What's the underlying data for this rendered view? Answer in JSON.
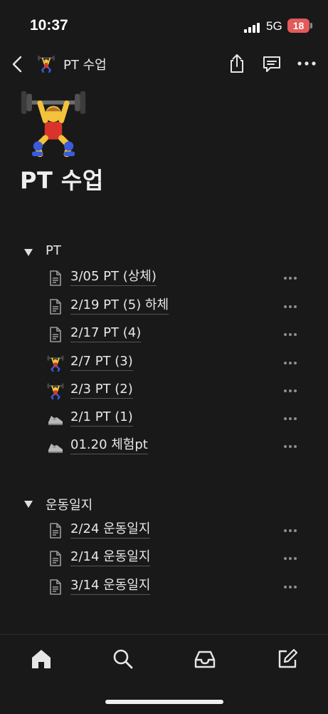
{
  "status": {
    "time": "10:37",
    "network": "5G",
    "battery": "18"
  },
  "nav": {
    "title": "PT 수업",
    "icons": [
      "back-chevron-icon",
      "weightlifter-emoji",
      "share-icon",
      "comment-icon",
      "more-icon"
    ]
  },
  "page": {
    "title": "PT 수업",
    "icon": "weightlifter-emoji"
  },
  "sections": [
    {
      "title": "PT",
      "items": [
        {
          "label": "3/05 PT (상체)",
          "icon": "page-icon"
        },
        {
          "label": "2/19 PT (5) 하체",
          "icon": "page-icon"
        },
        {
          "label": "2/17 PT (4)",
          "icon": "page-icon"
        },
        {
          "label": "2/7 PT (3)",
          "icon": "weightlifter-emoji"
        },
        {
          "label": "2/3 PT (2)",
          "icon": "weightlifter-emoji"
        },
        {
          "label": "2/1 PT (1)",
          "icon": "sneaker-emoji"
        },
        {
          "label": "01.20 체험pt",
          "icon": "sneaker-emoji"
        }
      ]
    },
    {
      "title": "운동일지",
      "items": [
        {
          "label": "2/24 운동일지",
          "icon": "page-icon"
        },
        {
          "label": "2/14 운동일지",
          "icon": "page-icon"
        },
        {
          "label": "3/14 운동일지",
          "icon": "page-icon"
        }
      ]
    }
  ],
  "tabbar": {
    "items": [
      "home-icon",
      "search-icon",
      "inbox-icon",
      "compose-icon"
    ]
  }
}
